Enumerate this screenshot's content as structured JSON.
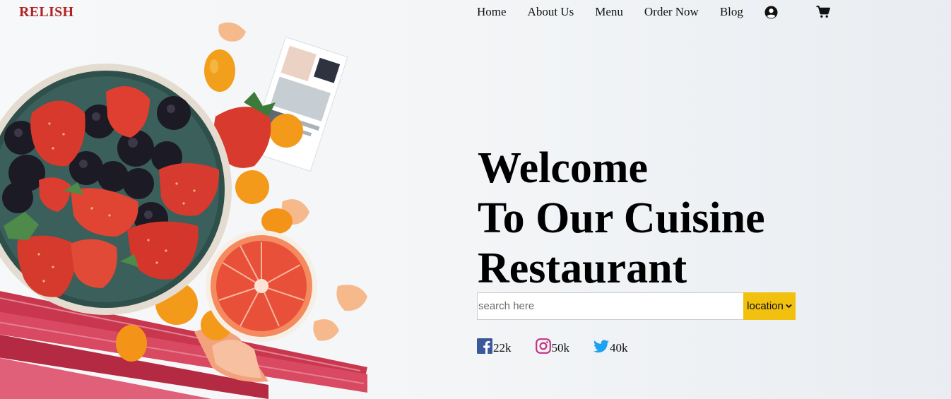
{
  "brand": {
    "name": "RELISH",
    "color": "#b22222"
  },
  "nav": {
    "items": [
      {
        "label": "Home"
      },
      {
        "label": "About Us"
      },
      {
        "label": "Menu"
      },
      {
        "label": "Order Now"
      },
      {
        "label": "Blog"
      }
    ],
    "icons": [
      "user-icon",
      "cart-icon"
    ]
  },
  "hero": {
    "line1": "Welcome",
    "line2": "To Our Cuisine",
    "line3": "Restaurant"
  },
  "search": {
    "placeholder": "search here",
    "value": "",
    "location_label": "location",
    "accent": "#f2c00f"
  },
  "social": [
    {
      "icon": "facebook-icon",
      "count": "22k",
      "color": "#3b5998"
    },
    {
      "icon": "instagram-icon",
      "count": "50k",
      "color": "#c13584"
    },
    {
      "icon": "twitter-icon",
      "count": "40k",
      "color": "#1da1f2"
    }
  ]
}
